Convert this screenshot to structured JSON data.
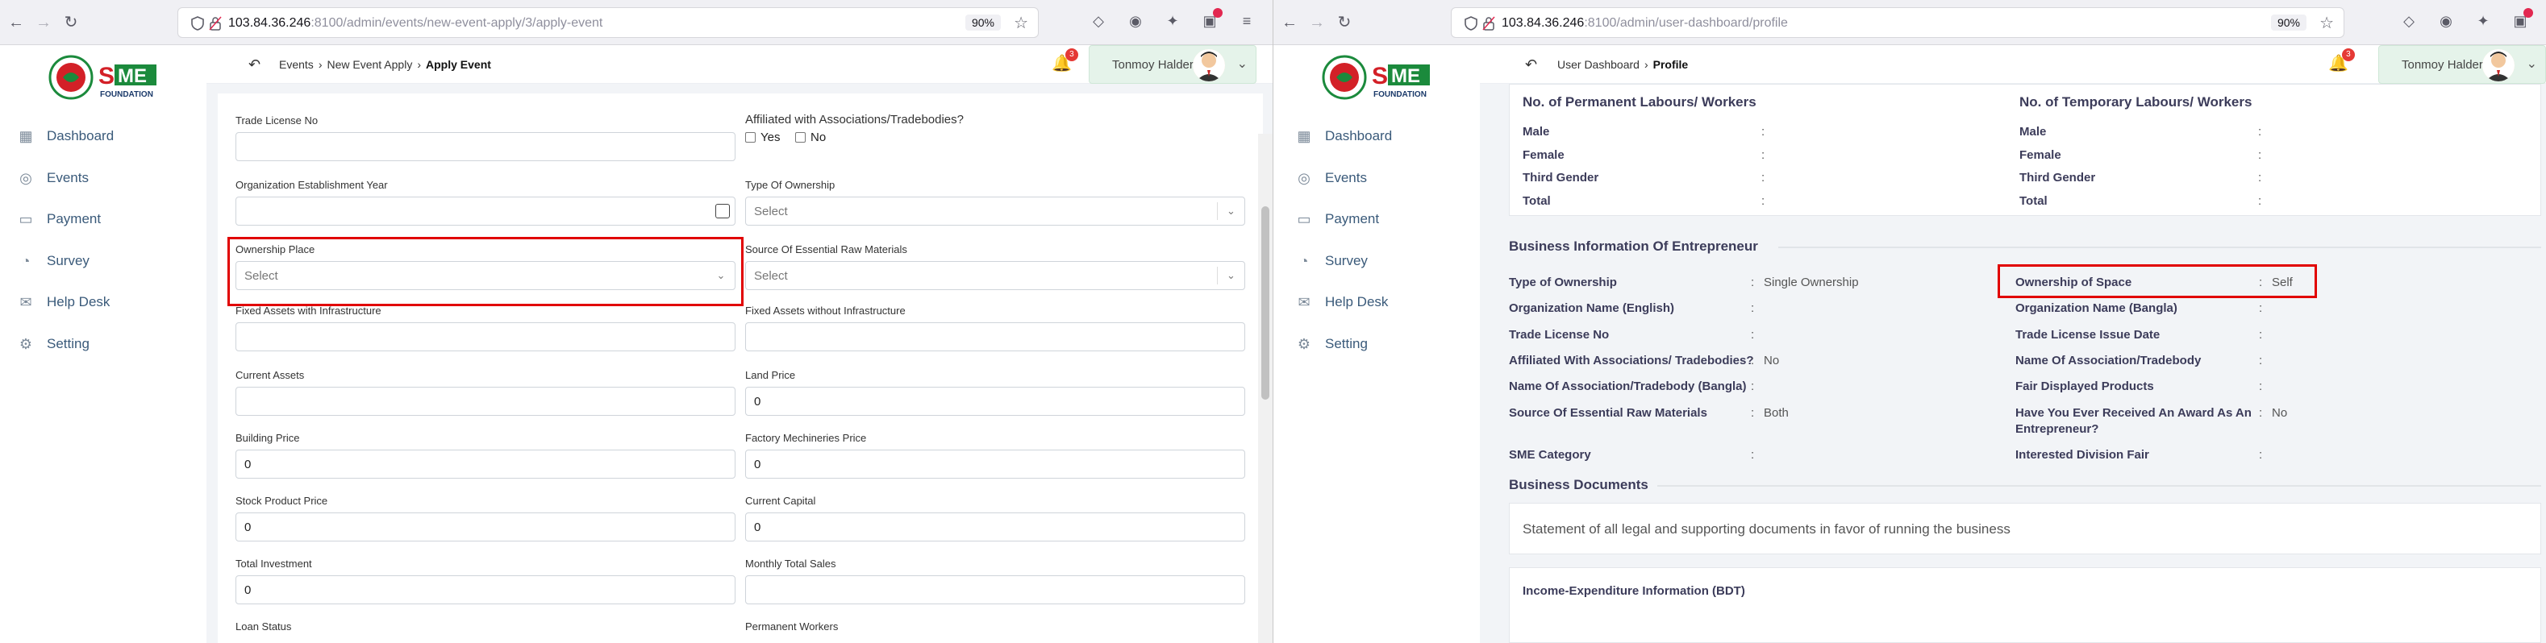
{
  "left": {
    "url": {
      "host": "103.84.36.246",
      "rest": ":8100/admin/events/new-event-apply/3/apply-event"
    },
    "zoom": "90%",
    "breadcrumb": [
      "Events",
      "New Event Apply",
      "Apply Event"
    ],
    "notification_count": "3",
    "user_name": "Tonmoy Halder",
    "sidebar": [
      "Dashboard",
      "Events",
      "Payment",
      "Survey",
      "Help Desk",
      "Setting"
    ],
    "form": {
      "trade_license_label": "Trade License No",
      "affiliated_label": "Affiliated with Associations/Tradebodies?",
      "yes": "Yes",
      "no": "No",
      "est_year_label": "Organization Establishment Year",
      "type_ownership_label": "Type Of Ownership",
      "type_ownership_value": "Select",
      "ownership_place_label": "Ownership Place",
      "ownership_place_value": "Select",
      "source_raw_label": "Source Of Essential Raw Materials",
      "source_raw_value": "Select",
      "fixed_with_label": "Fixed Assets with Infrastructure",
      "fixed_without_label": "Fixed Assets without Infrastructure",
      "current_assets_label": "Current Assets",
      "land_price_label": "Land Price",
      "land_price_value": "0",
      "building_price_label": "Building Price",
      "building_price_value": "0",
      "factory_label": "Factory Mechineries Price",
      "factory_value": "0",
      "stock_label": "Stock Product Price",
      "stock_value": "0",
      "current_capital_label": "Current Capital",
      "current_capital_value": "0",
      "total_investment_label": "Total Investment",
      "total_investment_value": "0",
      "monthly_sales_label": "Monthly Total Sales",
      "loan_status_label": "Loan Status",
      "permanent_workers_label": "Permanent Workers"
    }
  },
  "right": {
    "url": {
      "host": "103.84.36.246",
      "rest": ":8100/admin/user-dashboard/profile"
    },
    "zoom": "90%",
    "breadcrumb": [
      "User Dashboard",
      "Profile"
    ],
    "notification_count": "3",
    "user_name": "Tonmoy Halder",
    "sidebar": [
      "Dashboard",
      "Events",
      "Payment",
      "Survey",
      "Help Desk",
      "Setting"
    ],
    "labours": {
      "permanent_title": "No. of Permanent Labours/ Workers",
      "temporary_title": "No. of Temporary Labours/ Workers",
      "rows": [
        "Male",
        "Female",
        "Third Gender",
        "Total"
      ]
    },
    "business_info_title": "Business Information Of Entrepreneur",
    "business_left": [
      {
        "label": "Type of Ownership",
        "value": "Single Ownership"
      },
      {
        "label": "Organization Name (English)",
        "value": ""
      },
      {
        "label": "Trade License No",
        "value": ""
      },
      {
        "label": "Affiliated With Associations/ Tradebodies?",
        "value": "No"
      },
      {
        "label": "Name Of Association/Tradebody (Bangla)",
        "value": ""
      },
      {
        "label": "Source Of Essential Raw Materials",
        "value": "Both"
      },
      {
        "label": "SME Category",
        "value": ""
      }
    ],
    "business_right": [
      {
        "label": "Ownership of Space",
        "value": "Self"
      },
      {
        "label": "Organization Name (Bangla)",
        "value": ""
      },
      {
        "label": "Trade License Issue Date",
        "value": ""
      },
      {
        "label": "Name Of Association/Tradebody",
        "value": ""
      },
      {
        "label": "Fair Displayed Products",
        "value": ""
      },
      {
        "label": "Have You Ever Received An Award As An",
        "label2": "Entrepreneur?",
        "value": "No"
      },
      {
        "label": "Interested Division Fair",
        "value": ""
      }
    ],
    "documents_title": "Business Documents",
    "documents_text": "Statement of all legal and supporting documents in favor of running the business",
    "income_title": "Income-Expenditure Information (BDT)"
  },
  "colors": {
    "highlight": "#e10000",
    "sidebar_text": "#3a5a7a",
    "chip_bg": "#e5f3ea"
  }
}
